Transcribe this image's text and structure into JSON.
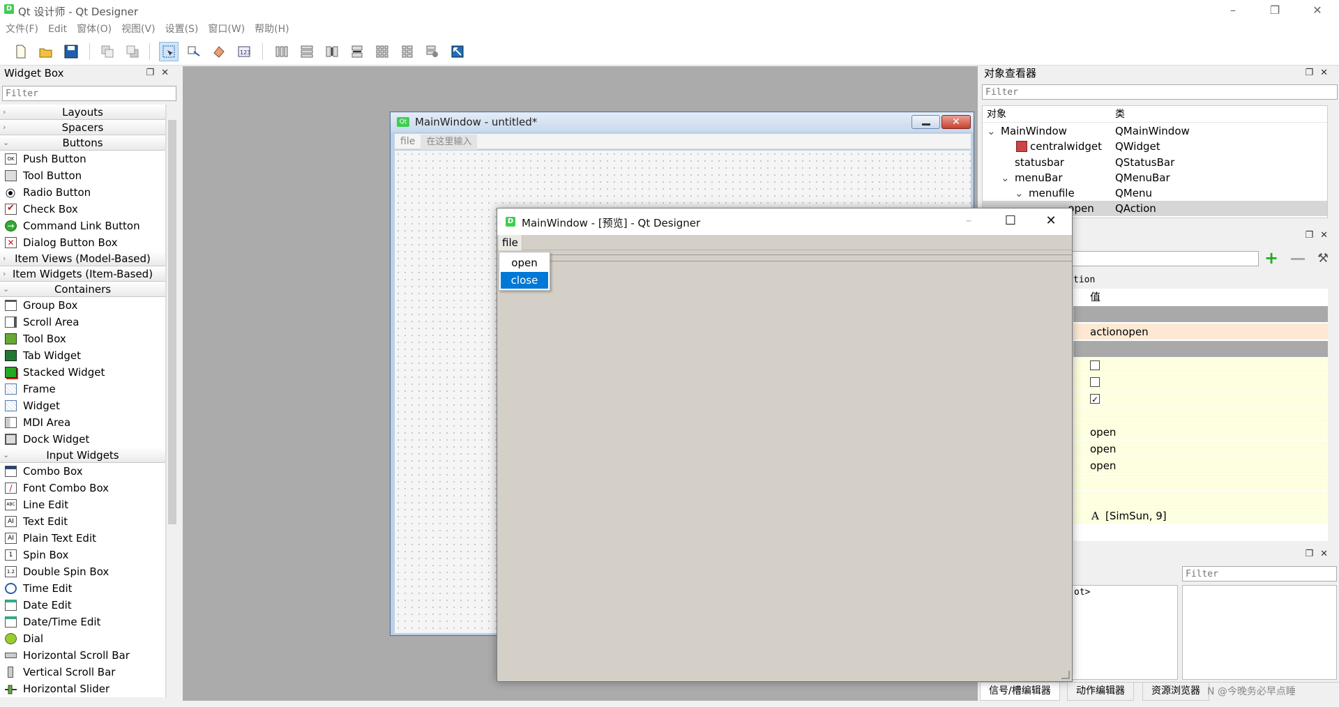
{
  "app": {
    "title": "Qt 设计师 - Qt Designer",
    "icon_glyph": "D",
    "menu": [
      "文件(F)",
      "Edit",
      "窗体(O)",
      "视图(V)",
      "设置(S)",
      "窗口(W)",
      "帮助(H)"
    ]
  },
  "widget_box": {
    "title": "Widget Box",
    "filter_placeholder": "Filter",
    "categories": {
      "layouts": "Layouts",
      "spacers": "Spacers",
      "buttons": "Buttons",
      "item_views": "Item Views (Model-Based)",
      "item_widgets": "Item Widgets (Item-Based)",
      "containers": "Containers",
      "input_widgets": "Input Widgets"
    },
    "buttons": [
      "Push Button",
      "Tool Button",
      "Radio Button",
      "Check Box",
      "Command Link Button",
      "Dialog Button Box"
    ],
    "containers": [
      "Group Box",
      "Scroll Area",
      "Tool Box",
      "Tab Widget",
      "Stacked Widget",
      "Frame",
      "Widget",
      "MDI Area",
      "Dock Widget"
    ],
    "input_widgets": [
      "Combo Box",
      "Font Combo Box",
      "Line Edit",
      "Text Edit",
      "Plain Text Edit",
      "Spin Box",
      "Double Spin Box",
      "Time Edit",
      "Date Edit",
      "Date/Time Edit",
      "Dial",
      "Horizontal Scroll Bar",
      "Vertical Scroll Bar",
      "Horizontal Slider"
    ]
  },
  "form_window": {
    "title": "MainWindow - untitled*",
    "icon_glyph": "Qt",
    "menu_file": "file",
    "menu_placeholder": "在这里输入"
  },
  "object_inspector": {
    "title": "对象查看器",
    "filter_placeholder": "Filter",
    "col_object": "对象",
    "col_class": "类",
    "rows": [
      {
        "name": "MainWindow",
        "cls": "QMainWindow"
      },
      {
        "name": "centralwidget",
        "cls": "QWidget"
      },
      {
        "name": "statusbar",
        "cls": "QStatusBar"
      },
      {
        "name": "menuBar",
        "cls": "QMenuBar"
      },
      {
        "name": "menufile",
        "cls": "QMenu"
      },
      {
        "name": "...open",
        "cls": "QAction"
      }
    ]
  },
  "property_editor": {
    "partial_label": "tion",
    "col_value": "值",
    "object_name": "actionopen",
    "text_1": "open",
    "text_2": "open",
    "text_3": "open",
    "font_glyph": "A",
    "font_value": "[SimSun, 9]"
  },
  "signal_dock": {
    "filter_placeholder": "Filter",
    "partial_text": "ot>"
  },
  "bottom_tabs": [
    "信号/槽编辑器",
    "动作编辑器",
    "资源浏览器"
  ],
  "watermark": "N @今晚务必早点睡",
  "preview": {
    "title": "MainWindow - [预览] - Qt Designer",
    "icon_glyph": "D",
    "menu_file": "file",
    "popup_items": [
      "open",
      "close"
    ]
  }
}
